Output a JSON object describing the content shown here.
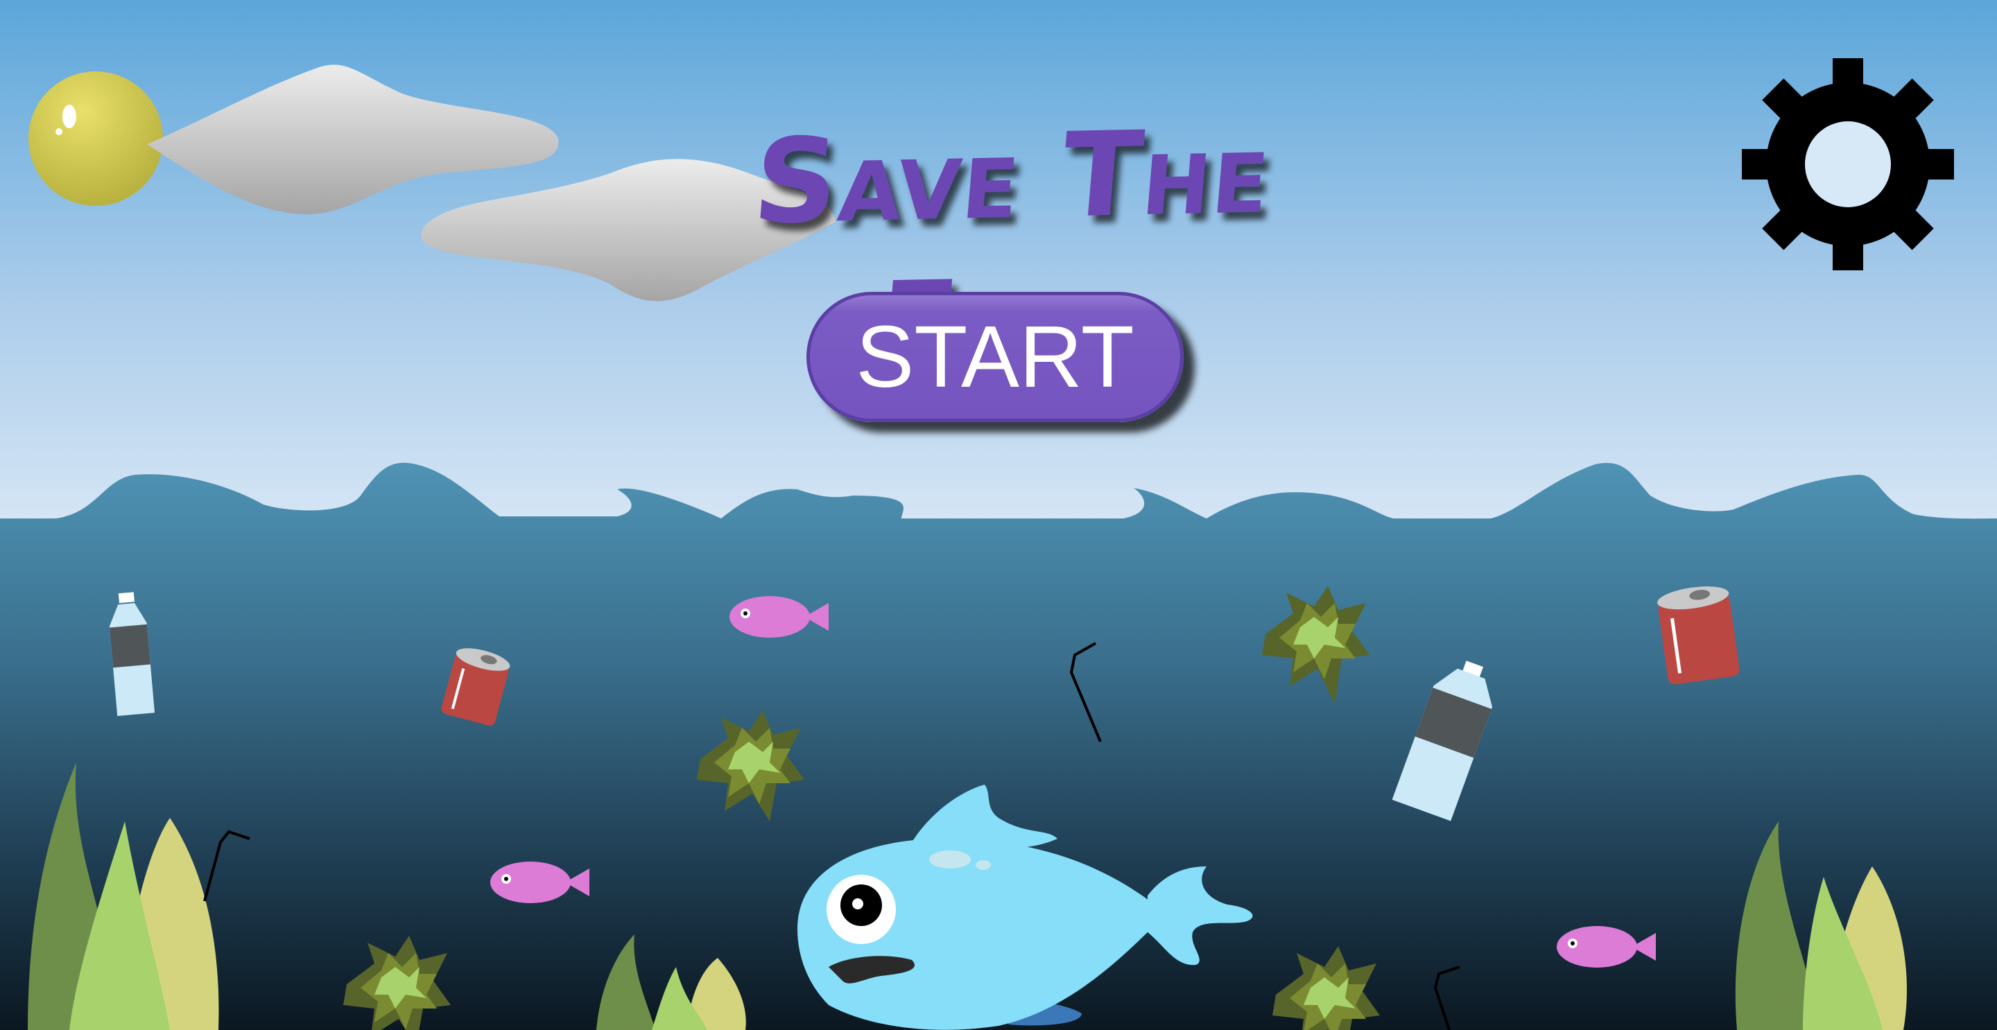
{
  "game": {
    "title": "Save The Fish",
    "start_label": "START",
    "settings_icon": "gear-icon"
  },
  "colors": {
    "sky_top": "#5ba6da",
    "sky_bottom": "#d2e4f4",
    "sea_top": "#4c8fb1",
    "sea_bottom": "#0d1a25",
    "title": "#6c46b3",
    "button": "#7756c1",
    "player_fish": "#86def9",
    "small_fish": "#dd7cd6",
    "sun": "#d1c957",
    "can": "#bb4743",
    "seaweed_dark": "#6e8f4a",
    "seaweed_light": "#a7d26c",
    "seaweed_pale": "#d4d47f",
    "algae": "#7b8b31"
  }
}
